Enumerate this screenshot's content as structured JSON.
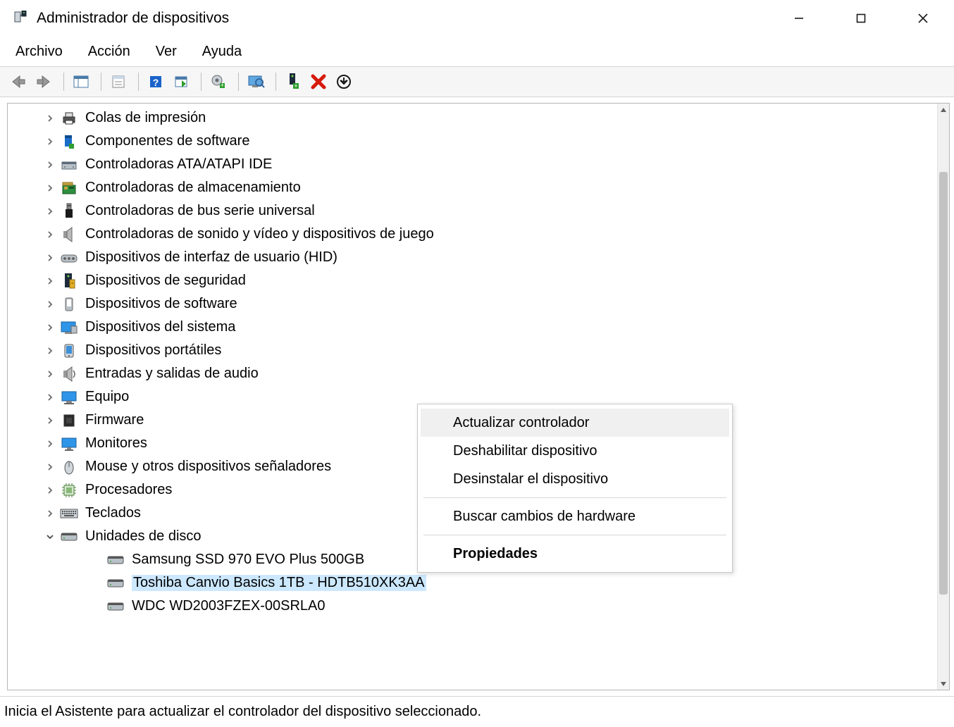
{
  "window": {
    "title": "Administrador de dispositivos"
  },
  "menubar": {
    "items": [
      "Archivo",
      "Acción",
      "Ver",
      "Ayuda"
    ]
  },
  "tree": {
    "nodes": [
      {
        "label": "Colas de impresión",
        "icon": "printer-icon",
        "expandable": true,
        "expanded": false,
        "level": 1
      },
      {
        "label": "Componentes de software",
        "icon": "software-component-icon",
        "expandable": true,
        "expanded": false,
        "level": 1
      },
      {
        "label": "Controladoras ATA/ATAPI IDE",
        "icon": "ide-controller-icon",
        "expandable": true,
        "expanded": false,
        "level": 1
      },
      {
        "label": "Controladoras de almacenamiento",
        "icon": "storage-controller-icon",
        "expandable": true,
        "expanded": false,
        "level": 1
      },
      {
        "label": "Controladoras de bus serie universal",
        "icon": "usb-icon",
        "expandable": true,
        "expanded": false,
        "level": 1
      },
      {
        "label": "Controladoras de sonido y vídeo y dispositivos de juego",
        "icon": "sound-icon",
        "expandable": true,
        "expanded": false,
        "level": 1
      },
      {
        "label": "Dispositivos de interfaz de usuario (HID)",
        "icon": "hid-icon",
        "expandable": true,
        "expanded": false,
        "level": 1
      },
      {
        "label": "Dispositivos de seguridad",
        "icon": "security-icon",
        "expandable": true,
        "expanded": false,
        "level": 1
      },
      {
        "label": "Dispositivos de software",
        "icon": "software-device-icon",
        "expandable": true,
        "expanded": false,
        "level": 1
      },
      {
        "label": "Dispositivos del sistema",
        "icon": "system-device-icon",
        "expandable": true,
        "expanded": false,
        "level": 1
      },
      {
        "label": "Dispositivos portátiles",
        "icon": "portable-device-icon",
        "expandable": true,
        "expanded": false,
        "level": 1
      },
      {
        "label": "Entradas y salidas de audio",
        "icon": "audio-io-icon",
        "expandable": true,
        "expanded": false,
        "level": 1
      },
      {
        "label": "Equipo",
        "icon": "computer-icon",
        "expandable": true,
        "expanded": false,
        "level": 1
      },
      {
        "label": "Firmware",
        "icon": "firmware-icon",
        "expandable": true,
        "expanded": false,
        "level": 1
      },
      {
        "label": "Monitores",
        "icon": "monitor-icon",
        "expandable": true,
        "expanded": false,
        "level": 1
      },
      {
        "label": "Mouse y otros dispositivos señaladores",
        "icon": "mouse-icon",
        "expandable": true,
        "expanded": false,
        "level": 1
      },
      {
        "label": "Procesadores",
        "icon": "processor-icon",
        "expandable": true,
        "expanded": false,
        "level": 1
      },
      {
        "label": "Teclados",
        "icon": "keyboard-icon",
        "expandable": true,
        "expanded": false,
        "level": 1
      },
      {
        "label": "Unidades de disco",
        "icon": "disk-icon",
        "expandable": true,
        "expanded": true,
        "level": 1
      },
      {
        "label": "Samsung SSD 970 EVO Plus 500GB",
        "icon": "disk-icon",
        "expandable": false,
        "expanded": false,
        "level": 2
      },
      {
        "label": "Toshiba Canvio Basics 1TB - HDTB510XK3AA",
        "icon": "disk-icon",
        "expandable": false,
        "expanded": false,
        "level": 2,
        "selected": true
      },
      {
        "label": "WDC WD2003FZEX-00SRLA0",
        "icon": "disk-icon",
        "expandable": false,
        "expanded": false,
        "level": 2
      }
    ]
  },
  "context_menu": {
    "items": [
      {
        "label": "Actualizar controlador",
        "hover": true
      },
      {
        "label": "Deshabilitar dispositivo"
      },
      {
        "label": "Desinstalar el dispositivo"
      },
      {
        "sep": true
      },
      {
        "label": "Buscar cambios de hardware"
      },
      {
        "sep": true
      },
      {
        "label": "Propiedades",
        "bold": true
      }
    ]
  },
  "statusbar": {
    "text": "Inicia el Asistente para actualizar el controlador del dispositivo seleccionado."
  }
}
